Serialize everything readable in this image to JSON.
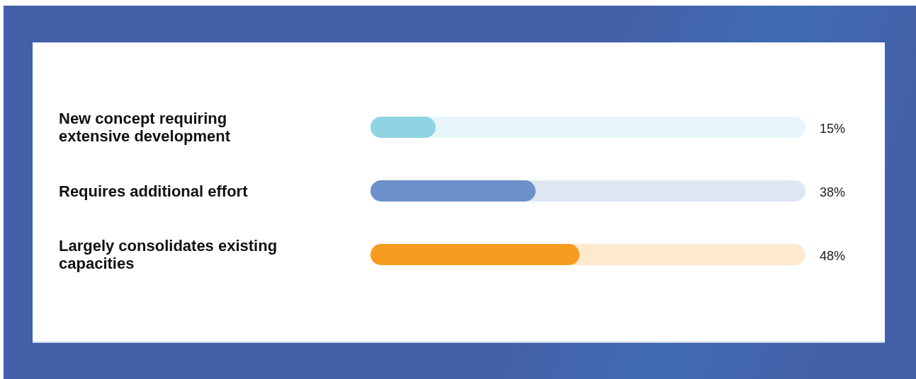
{
  "rows": [
    {
      "label": "New concept requiring extensive development",
      "level": 0.15,
      "reading": "15%",
      "color": "#8fd4e2"
    },
    {
      "label": "Requires additional effort",
      "level": 0.38,
      "reading": "38%",
      "color": "#6d8fca"
    },
    {
      "label": "Largely consolidates existing capacities",
      "level": 0.48,
      "reading": "48%",
      "color": "#f79b1e"
    }
  ]
}
